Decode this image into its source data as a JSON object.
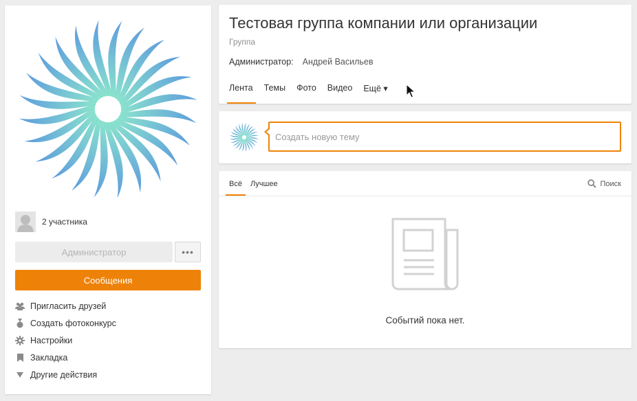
{
  "group": {
    "title": "Тестовая группа компании или организации",
    "type": "Группа",
    "admin_label": "Администратор:",
    "admin_name": "Андрей Васильев"
  },
  "tabs": [
    {
      "label": "Лента",
      "active": true
    },
    {
      "label": "Темы",
      "active": false
    },
    {
      "label": "Фото",
      "active": false
    },
    {
      "label": "Видео",
      "active": false
    },
    {
      "label": "Ещё ▾",
      "active": false
    }
  ],
  "sidebar": {
    "members_text": "2 участника",
    "admin_button": "Администратор",
    "more_button": "•••",
    "messages_button": "Сообщения",
    "actions": [
      {
        "label": "Пригласить друзей",
        "icon": "people-icon"
      },
      {
        "label": "Создать фотоконкурс",
        "icon": "medal-icon"
      },
      {
        "label": "Настройки",
        "icon": "gear-icon"
      },
      {
        "label": "Закладка",
        "icon": "bookmark-icon"
      },
      {
        "label": "Другие действия",
        "icon": "triangle-down-icon"
      }
    ]
  },
  "composer": {
    "placeholder": "Создать новую тему"
  },
  "feed": {
    "tabs": [
      {
        "label": "Всё",
        "active": true
      },
      {
        "label": "Лучшее",
        "active": false
      }
    ],
    "search_label": "Поиск",
    "empty_text": "Событий пока нет."
  },
  "colors": {
    "accent": "#ee8208",
    "logo_start": "#4a90d9",
    "logo_end": "#7fe0c8"
  }
}
